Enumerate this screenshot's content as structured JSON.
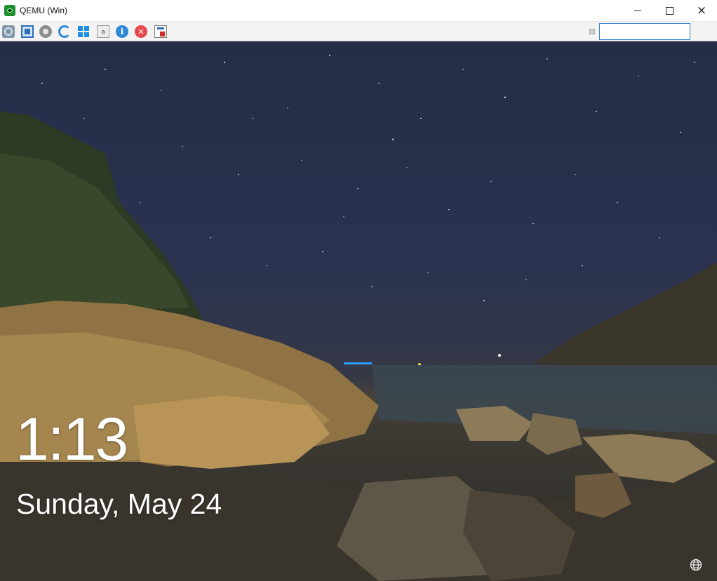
{
  "window": {
    "title": "QEMU (Win)",
    "icon": "qemu-app-icon",
    "controls": {
      "minimize": "minimize-icon",
      "maximize": "maximize-icon",
      "close": "×"
    }
  },
  "toolbar": {
    "buttons": [
      {
        "name": "network-icon"
      },
      {
        "name": "fullscreen-icon"
      },
      {
        "name": "settings-gear-icon"
      },
      {
        "name": "refresh-icon"
      },
      {
        "name": "windows-logo-icon"
      },
      {
        "name": "keyboard-icon",
        "glyph": "a"
      },
      {
        "name": "info-icon",
        "glyph": "i"
      },
      {
        "name": "stop-icon",
        "glyph": "×"
      },
      {
        "name": "save-snapshot-icon"
      }
    ],
    "search_value": ""
  },
  "lockscreen": {
    "time": "1:13",
    "date": "Sunday, May 24",
    "network_icon": "globe-network-icon"
  },
  "colors": {
    "sky": "#262d47",
    "accent": "#3c86d7"
  }
}
